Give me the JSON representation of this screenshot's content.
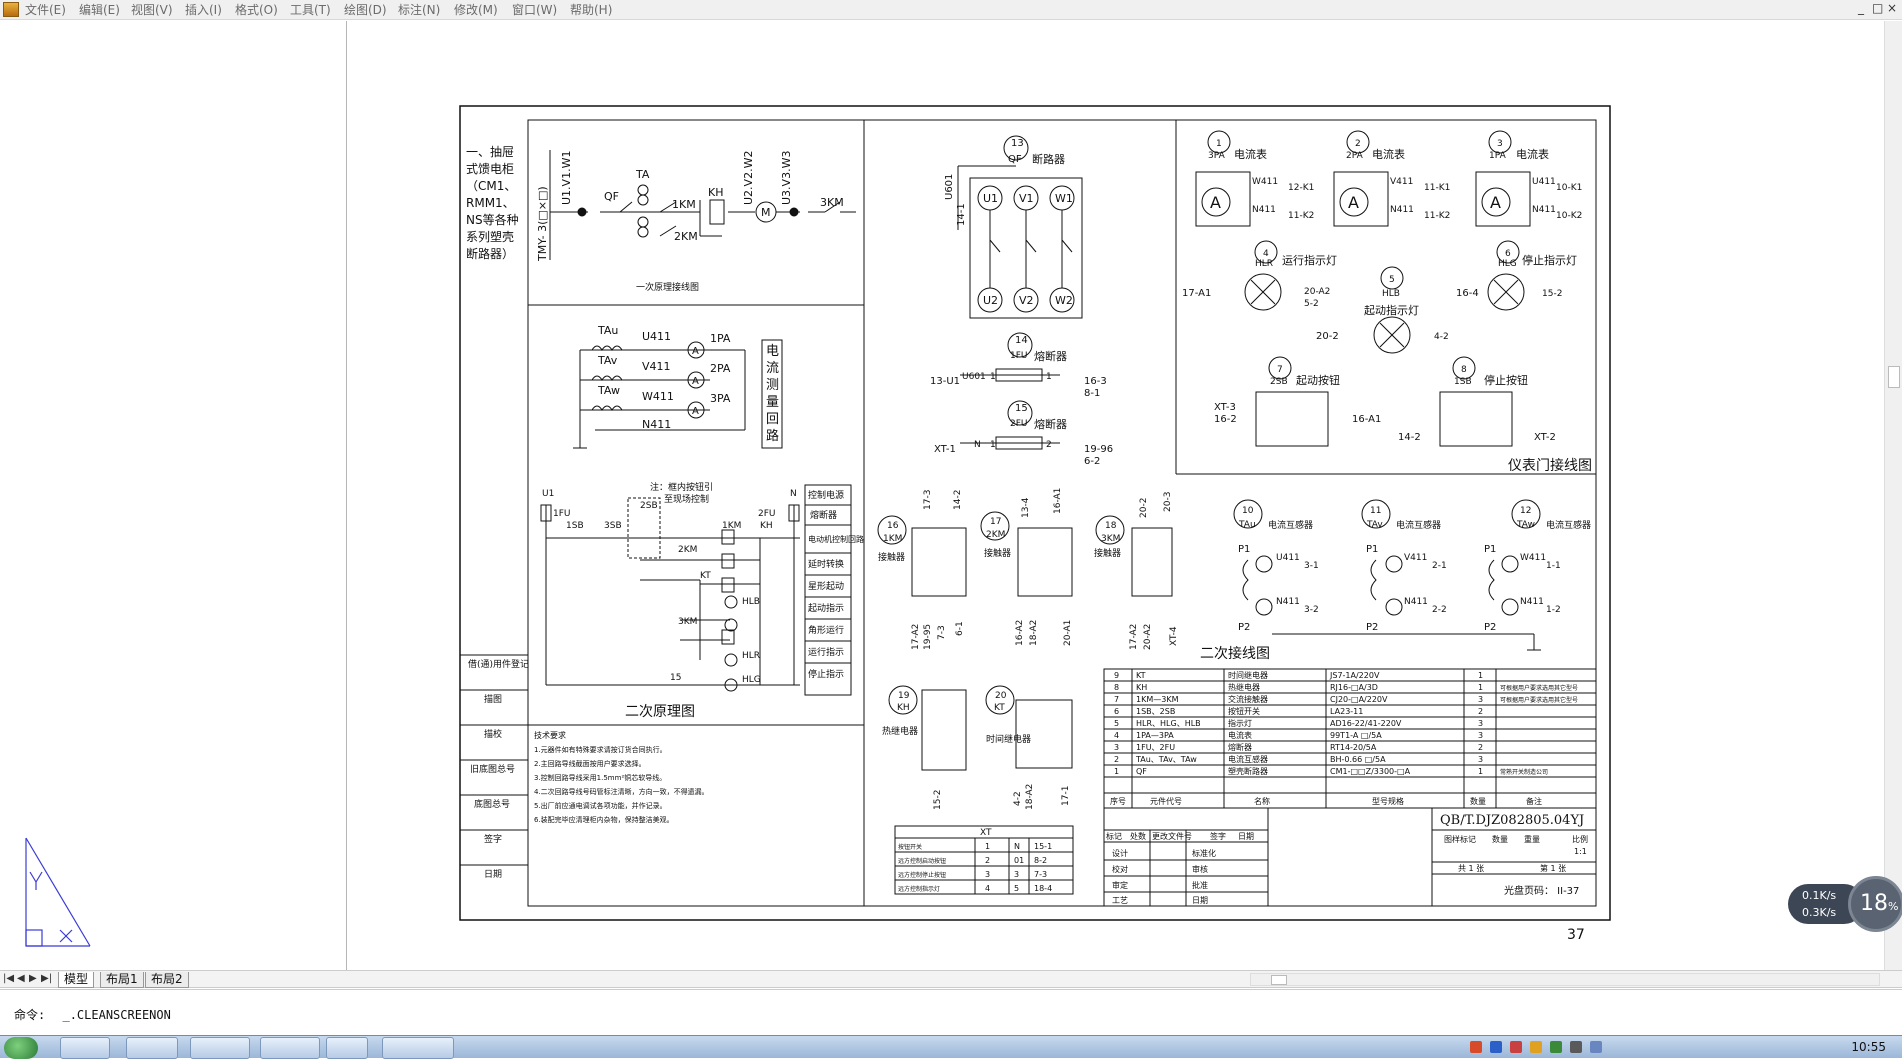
{
  "menu": {
    "items": [
      "文件(E)",
      "编辑(E)",
      "视图(V)",
      "插入(I)",
      "格式(O)",
      "工具(T)",
      "绘图(D)",
      "标注(N)",
      "修改(M)",
      "窗口(W)",
      "帮助(H)"
    ],
    "window_controls": [
      "_",
      "□",
      "×"
    ]
  },
  "drawing": {
    "part1_title": [
      "一、抽屉",
      "式馈电柜",
      "（CM1、",
      "RMM1、",
      "NS等各种",
      "系列塑壳",
      "断路器）"
    ],
    "main_circuit": {
      "bus_label": "TMY- 3(□×□)",
      "top_labels": [
        "U1.V1.W1",
        "U2.V2.W2",
        "U3.V3.W3"
      ],
      "components": [
        "QF",
        "TA",
        "1KM",
        "KH",
        "2KM",
        "3KM",
        "M"
      ],
      "caption": "一次原理接线图"
    },
    "measure_circuit": {
      "cts": [
        "TAu",
        "TAv",
        "TAw"
      ],
      "wires": [
        "U411",
        "V411",
        "W411",
        "N411"
      ],
      "meters": [
        "1PA",
        "2PA",
        "3PA"
      ],
      "meter_symbol": "A",
      "title_chars": [
        "电",
        "流",
        "测",
        "量",
        "回",
        "路"
      ]
    },
    "control_circuit": {
      "note": [
        "注：框内按钮引",
        "至现场控制"
      ],
      "labels": [
        "U1",
        "N",
        "1FU",
        "2FU",
        "1SB",
        "2SB",
        "3SB",
        "1KM",
        "2KM",
        "3KM",
        "KT",
        "KH",
        "HLR",
        "HLB",
        "HLG",
        "15"
      ],
      "right_labels": [
        "控制电源",
        "熔断器",
        "电动机控制回路",
        "延时转换",
        "星形起动",
        "起动指示",
        "角形运行",
        "运行指示",
        "停止指示"
      ],
      "caption": "二次原理图"
    },
    "breaker_block": {
      "num": "13",
      "code": "QF",
      "name": "断路器",
      "wire": "U601",
      "wire2": "14-1",
      "top_terms": [
        "U1",
        "V1",
        "W1"
      ],
      "bottom_terms": [
        "U2",
        "V2",
        "W2"
      ]
    },
    "fuses": [
      {
        "num": "14",
        "code": "1FU",
        "name": "熔断器",
        "left": "13-U1",
        "wire": "U601",
        "t1": "1",
        "t2": "1",
        "right": [
          "16-3",
          "8-1"
        ]
      },
      {
        "num": "15",
        "code": "2FU",
        "name": "熔断器",
        "left": "XT-1",
        "wire": "N",
        "t1": "1",
        "t2": "2",
        "right": [
          "19-96",
          "6-2"
        ]
      }
    ],
    "contactors": [
      {
        "num": "16",
        "code": "1KM",
        "name": "接触器",
        "top": [
          "5-3",
          "17-3",
          "7-4",
          "14-2"
        ],
        "bottom": [
          "17-A2",
          "19-95",
          "7-3",
          "3",
          "6-1",
          "15"
        ]
      },
      {
        "num": "17",
        "code": "2KM",
        "name": "接触器",
        "top": [
          "13-4",
          "5-1",
          "5",
          "16-A1",
          "18-4"
        ],
        "bottom": [
          "16-A2",
          "18-A2",
          "4",
          "3",
          "7",
          "20-A1"
        ]
      },
      {
        "num": "18",
        "code": "3KM",
        "name": "接触器",
        "top": [
          "9",
          "20-2",
          "11",
          "17-2",
          "20-3"
        ],
        "bottom": [
          "17-A2",
          "20-A2",
          "18-3",
          "5",
          "XT-4"
        ]
      }
    ],
    "relays": [
      {
        "num": "19",
        "code": "KH",
        "name": "热继电器",
        "top": [
          "4",
          "16-A2"
        ],
        "bottom": [
          "15-2",
          "6"
        ]
      },
      {
        "num": "20",
        "code": "KT",
        "name": "时间继电器",
        "top": [
          "17-4",
          "18-3"
        ],
        "bottom": [
          "4-2",
          "18-A2",
          "4",
          "1",
          "17-1",
          "13"
        ]
      }
    ],
    "xt_table": {
      "title": "XT",
      "rows": [
        {
          "name": "按钮开关",
          "num": "1",
          "a": "N",
          "b": "15-1"
        },
        {
          "name": "远方控制启动按钮",
          "num": "2",
          "a": "01",
          "b": "8-2"
        },
        {
          "name": "远方控制停止按钮",
          "num": "3",
          "a": "3",
          "b": "7-3"
        },
        {
          "name": "远方控制指示灯",
          "num": "4",
          "a": "5",
          "b": "18-4"
        }
      ]
    },
    "door_panel": {
      "ammeters": [
        {
          "num": "1",
          "code": "3PA",
          "name": "电流表",
          "sym": "A",
          "w1": "W411",
          "w2": "N411",
          "r1": "12-K1",
          "r2": "11-K2"
        },
        {
          "num": "2",
          "code": "2PA",
          "name": "电流表",
          "sym": "A",
          "w1": "V411",
          "w2": "N411",
          "r1": "11-K1",
          "r2": "11-K2"
        },
        {
          "num": "3",
          "code": "1PA",
          "name": "电流表",
          "sym": "A",
          "w1": "U411",
          "w2": "N411",
          "r1": "10-K1",
          "r2": "10-K2"
        }
      ],
      "lamps": [
        {
          "num": "4",
          "code": "HLR",
          "name": "运行指示灯",
          "left": "17-A1",
          "lt": "13",
          "rt": "4",
          "right": [
            "20-A2",
            "5-2"
          ]
        },
        {
          "num": "5",
          "code": "HLB",
          "name": "起动指示灯",
          "left": "20-2",
          "lt": "9",
          "rt": "4",
          "right": [
            "4-2"
          ]
        },
        {
          "num": "6",
          "code": "HLG",
          "name": "停止指示灯",
          "left": "16-4",
          "lt": "15",
          "rt": "2",
          "right": [
            "15-2"
          ]
        }
      ],
      "buttons": [
        {
          "num": "7",
          "code": "2SB",
          "name": "起动按钮",
          "left": [
            "XT-3",
            "16-2"
          ],
          "right": "16-A1",
          "rt": "5"
        },
        {
          "num": "8",
          "code": "1SB",
          "name": "停止按钮",
          "left": [
            "14-2"
          ],
          "right": "XT-2",
          "rt": "01"
        }
      ],
      "caption": "仪表门接线图"
    },
    "ct_section": {
      "cts": [
        {
          "num": "10",
          "code": "TAu",
          "name": "电流互感器",
          "w": "U411",
          "r1": "3-1",
          "r2": "3-2"
        },
        {
          "num": "11",
          "code": "TAv",
          "name": "电流互感器",
          "w": "V411",
          "r1": "2-1",
          "r2": "2-2"
        },
        {
          "num": "12",
          "code": "TAw",
          "name": "电流互感器",
          "w": "W411",
          "r1": "1-1",
          "r2": "1-2"
        }
      ],
      "p1": "P1",
      "p2": "P2",
      "k1": "K1",
      "k2": "K2",
      "n": "N411",
      "caption": "二次接线图"
    },
    "parts_table": {
      "headers": [
        "序号",
        "元件代号",
        "名称",
        "型号规格",
        "数量",
        "备注"
      ],
      "rows": [
        {
          "no": "9",
          "code": "KT",
          "name": "时间继电器",
          "spec": "JS7-1A/220V",
          "qty": "1",
          "note": ""
        },
        {
          "no": "8",
          "code": "KH",
          "name": "热继电器",
          "spec": "RJ16-□A/3D",
          "qty": "1",
          "note": "可根据用户要求选用其它型号"
        },
        {
          "no": "7",
          "code": "1KM—3KM",
          "name": "交流接触器",
          "spec": "CJ20-□A/220V",
          "qty": "3",
          "note": "可根据用户要求选用其它型号"
        },
        {
          "no": "6",
          "code": "1SB、2SB",
          "name": "按钮开关",
          "spec": "LA23-11",
          "qty": "2",
          "note": ""
        },
        {
          "no": "5",
          "code": "HLR、HLG、HLB",
          "name": "指示灯",
          "spec": "AD16-22/41-220V",
          "qty": "3",
          "note": ""
        },
        {
          "no": "4",
          "code": "1PA—3PA",
          "name": "电流表",
          "spec": "99T1-A □/5A",
          "qty": "3",
          "note": ""
        },
        {
          "no": "3",
          "code": "1FU、2FU",
          "name": "熔断器",
          "spec": "RT14-20/5A",
          "qty": "2",
          "note": ""
        },
        {
          "no": "2",
          "code": "TAu、TAv、TAw",
          "name": "电流互感器",
          "spec": "BH-0.66 □/5A",
          "qty": "3",
          "note": ""
        },
        {
          "no": "1",
          "code": "QF",
          "name": "塑壳断路器",
          "spec": "CM1-□□Z/3300-□A",
          "qty": "1",
          "note": "常熟开关制造公司"
        }
      ]
    },
    "title_block": {
      "drawing_no": "QB/T.DJZ082805.04YJ",
      "stage": "图样标记",
      "weight": "数量",
      "qty": "重量",
      "scale": "比例",
      "scale_val": "1:1",
      "sheet_total": "共 1 张",
      "sheet_no": "第 1 张",
      "page_ref": "光盘页码：  II-37",
      "rev_headers": [
        "标记",
        "处数",
        "更改文件号",
        "签字",
        "日期"
      ],
      "roles": [
        "设计",
        "标准化",
        "校对",
        "审核",
        "审定",
        "批准",
        "工艺",
        "日期"
      ]
    },
    "left_sidebar": [
      "借(通)用件登记",
      "描图",
      "描校",
      "旧底图总号",
      "底图总号",
      "签字",
      "日期"
    ],
    "notes_title": "技术要求",
    "notes": [
      "1.元器件如有特殊要求请按订货合同执行。",
      "2.主回路导线截面按用户要求选择。",
      "3.控制回路导线采用1.5mm²铜芯软导线。",
      "4.二次回路导线号码管标注清晰，方向一致，不得遗漏。",
      "5.出厂前应通电调试各项功能，并作记录。",
      "6.装配完毕应清理柜内杂物，保持整洁美观。"
    ],
    "page_number": "37"
  },
  "tabs": {
    "nav": [
      "|◀",
      "◀",
      "▶",
      "▶|"
    ],
    "items": [
      "模型",
      "布局1",
      "布局2"
    ],
    "active": 0
  },
  "command": {
    "prompt": "命令:",
    "text": "_.CLEANSCREENON"
  },
  "taskbar": {
    "clock": "10:55"
  },
  "netwidget": {
    "up": "0.1K/s",
    "down": "0.3K/s",
    "pct": "18",
    "pct_unit": "%"
  },
  "colors": {
    "ucs_icon": "#3b3bd6",
    "paper_line": "#111111"
  }
}
